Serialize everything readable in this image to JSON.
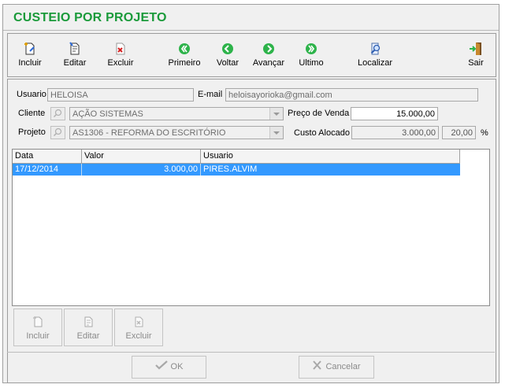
{
  "window": {
    "title": "CUSTEIO POR PROJETO"
  },
  "toolbar": {
    "incluir": "Incluir",
    "editar": "Editar",
    "excluir": "Excluir",
    "primeiro": "Primeiro",
    "voltar": "Voltar",
    "avancar": "Avançar",
    "ultimo": "Ultimo",
    "localizar": "Localizar",
    "sair": "Sair"
  },
  "form": {
    "usuario_label": "Usuario",
    "usuario_value": "HELOISA",
    "email_label": "E-mail",
    "email_value": "heloisayorioka@gmail.com",
    "cliente_label": "Cliente",
    "cliente_value": "AÇÃO SISTEMAS",
    "preco_label": "Preço de Venda",
    "preco_value": "15.000,00",
    "projeto_label": "Projeto",
    "projeto_value": "AS1306 - REFORMA DO ESCRITÓRIO",
    "custo_label": "Custo Alocado",
    "custo_value": "3.000,00",
    "custo_percent": "20,00",
    "percent_sign": "%"
  },
  "grid": {
    "columns": [
      "Data",
      "Valor",
      "Usuario"
    ],
    "rows": [
      {
        "data": "17/12/2014",
        "valor": "3.000,00",
        "usuario": "PIRES.ALVIM"
      }
    ]
  },
  "detail_buttons": {
    "incluir": "Incluir",
    "editar": "Editar",
    "excluir": "Excluir"
  },
  "footer": {
    "ok": "OK",
    "cancelar": "Cancelar"
  },
  "colors": {
    "title_green": "#1a9a3a",
    "nav_green": "#2db34a",
    "selection": "#3399ff"
  }
}
